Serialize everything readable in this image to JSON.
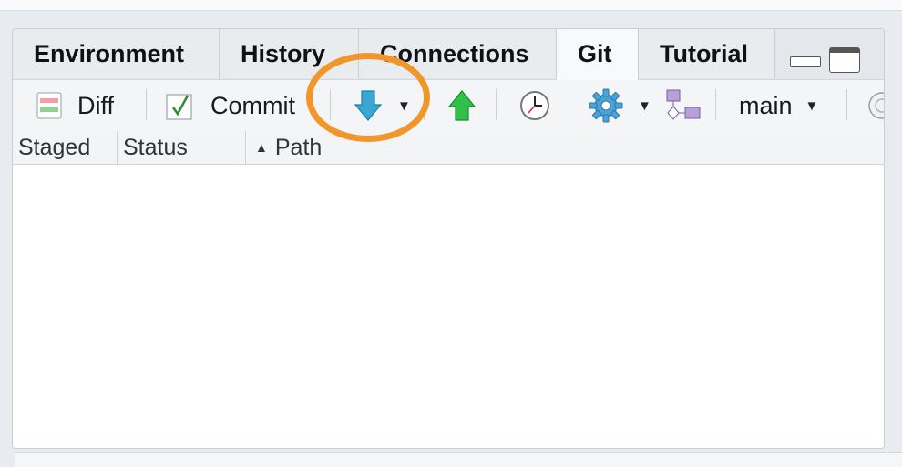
{
  "tabs": [
    {
      "label": "Environment",
      "active": false
    },
    {
      "label": "History",
      "active": false
    },
    {
      "label": "Connections",
      "active": false
    },
    {
      "label": "Git",
      "active": true
    },
    {
      "label": "Tutorial",
      "active": false
    }
  ],
  "toolbar": {
    "diff_label": "Diff",
    "commit_label": "Commit",
    "branch_label": "main"
  },
  "table": {
    "columns": [
      "Staged",
      "Status",
      "Path"
    ],
    "sort_column": "Path",
    "rows": []
  },
  "colors": {
    "highlight_ring": "#f0962b",
    "pull_arrow": "#3aa6d6",
    "push_arrow": "#2fbf4a"
  },
  "icons": {
    "diff": "diff-icon",
    "commit": "commit-checkbox-icon",
    "pull": "pull-down-arrow-icon",
    "push": "push-up-arrow-icon",
    "history": "clock-icon",
    "more": "gear-icon",
    "branch": "branch-diagram-icon"
  }
}
